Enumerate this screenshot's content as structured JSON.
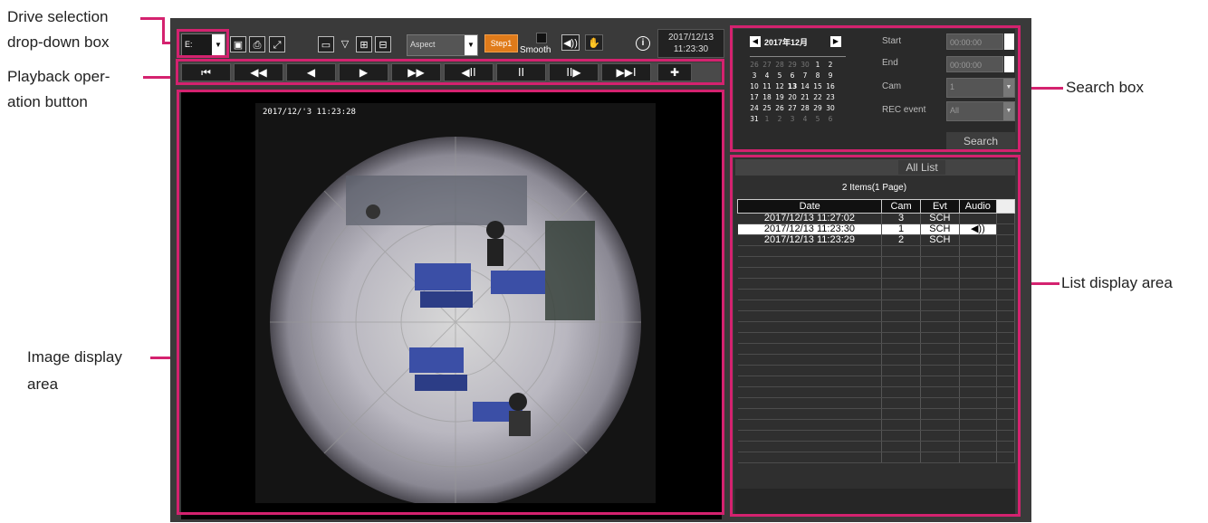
{
  "callouts": {
    "drive_line1": "Drive selection",
    "drive_line2": "drop-down box",
    "playback_line1": "Playback oper-",
    "playback_line2": "ation button",
    "image_line1": "Image display",
    "image_line2": "area",
    "search": "Search box",
    "list": "List display area"
  },
  "toolbar": {
    "drive_value": "E:",
    "aspect_label": "Aspect",
    "step_label": "Step1",
    "smooth_label": "Smooth",
    "date": "2017/12/13",
    "time": "11:23:30",
    "info_icon": "info-icon"
  },
  "playback_buttons": [
    {
      "name": "skip-to-start-button",
      "glyph": "⏮"
    },
    {
      "name": "fast-rewind-button",
      "glyph": "◀◀"
    },
    {
      "name": "reverse-play-button",
      "glyph": "◀"
    },
    {
      "name": "play-button",
      "glyph": "▶"
    },
    {
      "name": "fast-forward-button",
      "glyph": "▶▶"
    },
    {
      "name": "previous-frame-button",
      "glyph": "◀II"
    },
    {
      "name": "pause-button",
      "glyph": "II"
    },
    {
      "name": "next-frame-button",
      "glyph": "II▶"
    },
    {
      "name": "skip-to-end-button",
      "glyph": "▶▶I"
    }
  ],
  "image": {
    "timestamp": "2017/12/'3 11:23:28"
  },
  "search": {
    "month_label": "2017年12月",
    "calendar": [
      [
        "26",
        "27",
        "28",
        "29",
        "30",
        "1",
        "2"
      ],
      [
        "3",
        "4",
        "5",
        "6",
        "7",
        "8",
        "9"
      ],
      [
        "10",
        "11",
        "12",
        "13",
        "14",
        "15",
        "16"
      ],
      [
        "17",
        "18",
        "19",
        "20",
        "21",
        "22",
        "23"
      ],
      [
        "24",
        "25",
        "26",
        "27",
        "28",
        "29",
        "30"
      ],
      [
        "31",
        "1",
        "2",
        "3",
        "4",
        "5",
        "6"
      ]
    ],
    "start_label": "Start",
    "start_value": "00:00:00",
    "end_label": "End",
    "end_value": "00:00:00",
    "cam_label": "Cam",
    "cam_value": "1",
    "rec_event_label": "REC event",
    "rec_event_value": "All",
    "search_button": "Search"
  },
  "list": {
    "tab_label": "All List",
    "summary": "2 Items(1 Page)",
    "columns": [
      "Date",
      "Cam",
      "Evt",
      "Audio"
    ],
    "rows": [
      {
        "date": "2017/12/13 11:27:02",
        "cam": "3",
        "evt": "SCH",
        "audio": ""
      },
      {
        "date": "2017/12/13 11:23:30",
        "cam": "1",
        "evt": "SCH",
        "audio": "◀))"
      },
      {
        "date": "2017/12/13 11:23:29",
        "cam": "2",
        "evt": "SCH",
        "audio": ""
      }
    ],
    "selected_row": 1
  },
  "colors": {
    "accent": "#d4226f",
    "step": "#e07b1a",
    "panel": "#3a3a3a"
  }
}
